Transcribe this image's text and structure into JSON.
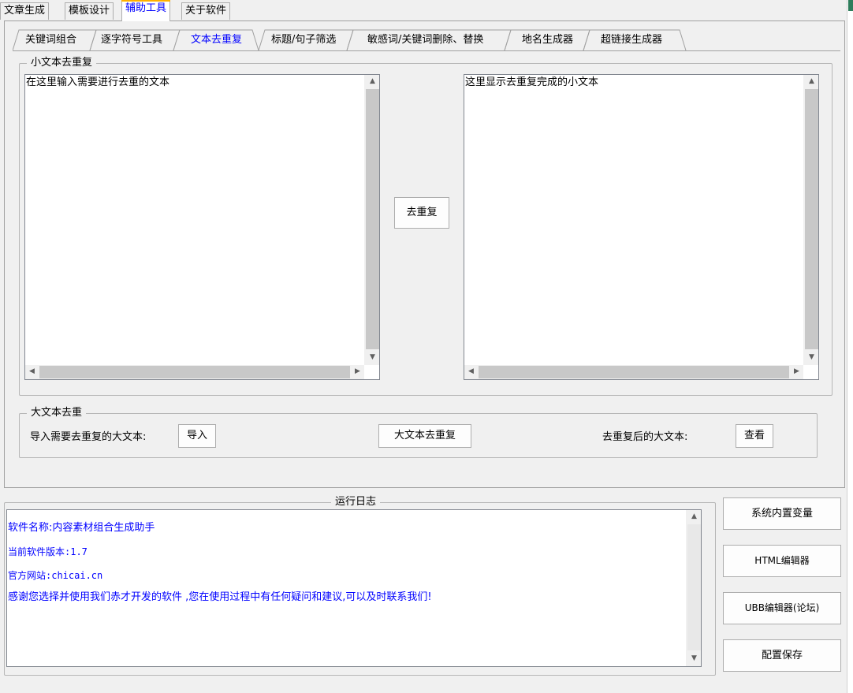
{
  "top_tabs": [
    {
      "label": "文章生成",
      "active": false
    },
    {
      "label": "模板设计",
      "active": false
    },
    {
      "label": "辅助工具",
      "active": true
    },
    {
      "label": "关于软件",
      "active": false
    }
  ],
  "sub_tabs": [
    {
      "label": "关键词组合",
      "active": false
    },
    {
      "label": "逐字符号工具",
      "active": false
    },
    {
      "label": "文本去重复",
      "active": true
    },
    {
      "label": "标题/句子筛选",
      "active": false
    },
    {
      "label": "敏感词/关键词删除、替换",
      "active": false
    },
    {
      "label": "地名生成器",
      "active": false
    },
    {
      "label": "超链接生成器",
      "active": false
    }
  ],
  "small_dedup": {
    "title": "小文本去重复",
    "input_text": "在这里输入需要进行去重的文本",
    "output_text": "这里显示去重复完成的小文本",
    "dedup_button": "去重复"
  },
  "big_dedup": {
    "title": "大文本去重",
    "import_label": "导入需要去重复的大文本:",
    "import_button": "导入",
    "dedup_button": "大文本去重复",
    "result_label": "去重复后的大文本:",
    "view_button": "查看"
  },
  "log": {
    "title": "运行日志",
    "lines": [
      "软件名称:内容素材组合生成助手",
      "当前软件版本:1.7",
      "官方网站:chicai.cn",
      "感谢您选择并使用我们赤才开发的软件 ,您在使用过程中有任何疑问和建议,可以及时联系我们!"
    ]
  },
  "side_buttons": [
    "系统内置变量",
    "HTML编辑器",
    "UBB编辑器(论坛)",
    "配置保存"
  ],
  "colors": {
    "accent": "#0000ff",
    "active_tab_marker": "#ffb000"
  }
}
